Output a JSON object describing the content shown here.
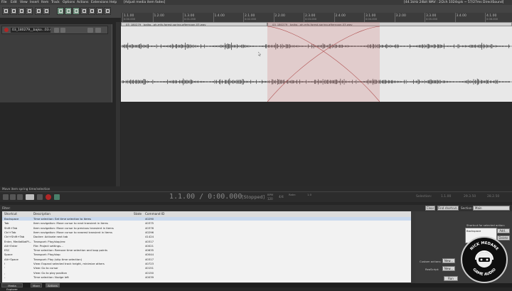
{
  "menubar": {
    "items": [
      "File",
      "Edit",
      "View",
      "Insert",
      "Item",
      "Track",
      "Options",
      "Actions",
      "Extensions",
      "Help"
    ],
    "title": "[Adjust media item fades]",
    "status": "[44.1kHz 24bit WAV : 2/2ch 1024spls ~ 57/27ms DirectSound]"
  },
  "timeline": {
    "ticks": [
      "1.1.00",
      "1.2.00",
      "1.3.00",
      "1.4.00",
      "2.1.00",
      "2.2.00",
      "2.3.00",
      "2.4.00",
      "3.1.00",
      "3.2.00",
      "3.3.00",
      "3.4.00",
      "4.1.00",
      "4.2.00"
    ],
    "subticks": [
      "0:00.000",
      "",
      "0:01.000",
      "",
      "0:02.000",
      "",
      "0:03.000",
      "",
      "0:04.000",
      "",
      "0:05.000",
      "",
      "0:06.000",
      ""
    ]
  },
  "track": {
    "name": "03_180279__bajko...03.wav",
    "items": [
      "03_180279__bajko...ah-mfx-forest-spring-afternoon-03.wav",
      "03_180279__bajko...ah-mfx-forest-spring-afternoon-03.wav"
    ]
  },
  "status": {
    "text": "Move item spring time/selection"
  },
  "transport": {
    "time": "1.1.00 / 0:00.000",
    "state": "[Stopped]",
    "bpm_label": "BPM",
    "bpm": "120",
    "timesig": "4/4",
    "rate_label": "Rate:",
    "rate": "1.0",
    "selection_label": "Selection:",
    "sel_start": "1.1.00",
    "sel_end": "29.3.50",
    "sel_len": "28.2.50"
  },
  "actions": {
    "filter_label": "Filter:",
    "clear_label": "Clear",
    "find_shortcut_label": "Find shortcut...",
    "section_label": "Section:",
    "section_value": "Main",
    "columns": {
      "shortcut": "Shortcut",
      "description": "Description",
      "state": "State",
      "command_id": "Command ID"
    },
    "rows": [
      {
        "shortcut": "Backspace",
        "description": "Time selection: Set time selection to items",
        "state": "",
        "id": "40290"
      },
      {
        "shortcut": "Tab",
        "description": "Item navigation: Move cursor to next transient in items",
        "state": "",
        "id": "40375"
      },
      {
        "shortcut": "Shift+Tab",
        "description": "Item navigation: Move cursor to previous transient in items",
        "state": "",
        "id": "40376"
      },
      {
        "shortcut": "Ctrl+Tab",
        "description": "Item navigation: Move cursor to nearest transient in items",
        "state": "",
        "id": "40296"
      },
      {
        "shortcut": "Ctrl+Shift+Tab",
        "description": "Docker: Activate next tab",
        "state": "",
        "id": "41424"
      },
      {
        "shortcut": "Enter, MediaKbdPl...",
        "description": "Transport: Play/stop/rec",
        "state": "",
        "id": "40317"
      },
      {
        "shortcut": "Alt+Enter",
        "description": "File: Project settings...",
        "state": "",
        "id": "40021"
      },
      {
        "shortcut": "ESC",
        "description": "Time selection: Remove time selection and loop points",
        "state": "",
        "id": "40635"
      },
      {
        "shortcut": "Space",
        "description": "Transport: Play/stop",
        "state": "",
        "id": "40044"
      },
      {
        "shortcut": "Alt+Space",
        "description": "Transport: Play (skip time selection)",
        "state": "",
        "id": "40317"
      },
      {
        "shortcut": "!",
        "description": "View: Expand selected track height, minimize others",
        "state": "",
        "id": "40723"
      },
      {
        "shortcut": "'",
        "description": "View: Go to cursor",
        "state": "",
        "id": "40151"
      },
      {
        "shortcut": ",",
        "description": "View: Go to play position",
        "state": "",
        "id": "40150"
      },
      {
        "shortcut": "-",
        "description": "Time selection: Nudge left",
        "state": "",
        "id": "40039"
      }
    ],
    "shortcut_for_action_label": "Shortcut for selected action:",
    "selected_shortcut": "Backspace",
    "add_label": "Add...",
    "delete_label": "Delete",
    "custom_actions_label": "Custom actions:",
    "new_label": "New...",
    "reascript_label": "ReaScript:",
    "run_label": "Run"
  },
  "tabs": [
    "Media Explorer",
    "Mixer",
    "Actions"
  ],
  "logo": {
    "top": "NICK MEDANE",
    "bottom": "GAME AUDIO"
  },
  "colors": {
    "crossfade": "#cd7878",
    "item_bg": "#e8e8e8",
    "accent": "#6d8f7b"
  }
}
